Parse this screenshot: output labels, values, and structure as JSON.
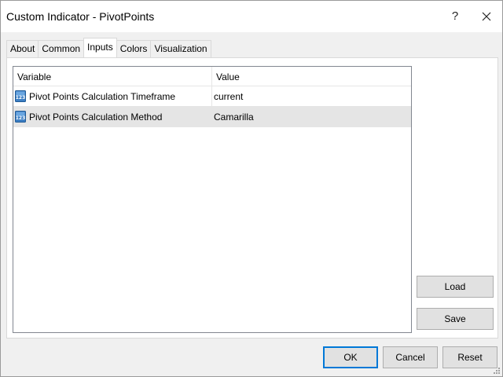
{
  "window": {
    "title": "Custom Indicator - PivotPoints",
    "help_label": "?"
  },
  "tabs": [
    {
      "label": "About",
      "active": false
    },
    {
      "label": "Common",
      "active": false
    },
    {
      "label": "Inputs",
      "active": true
    },
    {
      "label": "Colors",
      "active": false
    },
    {
      "label": "Visualization",
      "active": false
    }
  ],
  "grid": {
    "columns": [
      "Variable",
      "Value"
    ],
    "rows": [
      {
        "icon": "numeric-123-icon",
        "variable": "Pivot Points Calculation Timeframe",
        "value": "current",
        "selected": false
      },
      {
        "icon": "numeric-123-icon",
        "variable": "Pivot Points Calculation Method",
        "value": "Camarilla",
        "selected": true
      }
    ]
  },
  "side_buttons": {
    "load": "Load",
    "save": "Save"
  },
  "footer_buttons": {
    "ok": "OK",
    "cancel": "Cancel",
    "reset": "Reset"
  },
  "colors": {
    "accent": "#0078d7",
    "selection": "#e5e5e5"
  }
}
